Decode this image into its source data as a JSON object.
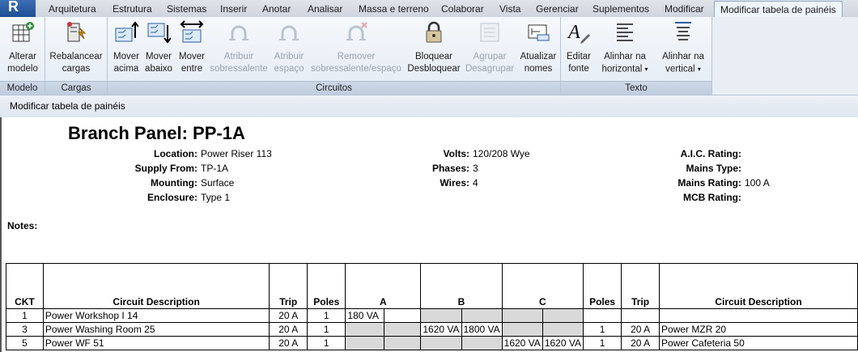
{
  "ribbon": {
    "app_button": "R",
    "tabs": [
      "Arquitetura",
      "Estrutura",
      "Sistemas",
      "Inserir",
      "Anotar",
      "Analisar",
      "Massa e terreno",
      "Colaborar",
      "Vista",
      "Gerenciar",
      "Suplementos",
      "Modificar",
      "Modificar tabela de painéis"
    ],
    "active_tab": "Modificar tabela de painéis",
    "panels": {
      "modelo": {
        "label": "Modelo",
        "buttons": [
          {
            "line1": "Alterar",
            "line2": "modelo",
            "icon": "table-swap-icon"
          }
        ]
      },
      "cargas": {
        "label": "Cargas",
        "buttons": [
          {
            "line1": "Rebalancear",
            "line2": "cargas",
            "icon": "rebalance-icon"
          }
        ]
      },
      "circuitos": {
        "label": "Circuitos",
        "buttons": [
          {
            "line1": "Mover",
            "line2": "acima",
            "icon": "move-up-icon"
          },
          {
            "line1": "Mover",
            "line2": "abaixo",
            "icon": "move-down-icon"
          },
          {
            "line1": "Mover",
            "line2": "entre",
            "icon": "move-across-icon"
          },
          {
            "line1": "Atribuir",
            "line2": "sobressalente",
            "icon": "assign-spare-icon"
          },
          {
            "line1": "Atribuir",
            "line2": "espaço",
            "icon": "assign-space-icon"
          },
          {
            "line1": "Remover",
            "line2": "sobressalente/espaço",
            "icon": "remove-spare-icon"
          },
          {
            "line1": "Bloquear",
            "line2": "Desbloquear",
            "icon": "lock-icon"
          },
          {
            "line1": "Agrupar",
            "line2": "Desagrupar",
            "icon": "group-icon"
          },
          {
            "line1": "Atualizar",
            "line2": "nomes",
            "icon": "update-names-icon"
          }
        ]
      },
      "texto": {
        "label": "Texto",
        "buttons": [
          {
            "line1": "Editar",
            "line2": "fonte",
            "icon": "font-edit-icon"
          },
          {
            "line1": "Alinhar na",
            "line2": "horizontal",
            "icon": "align-horizontal-icon"
          },
          {
            "line1": "Alinhar na",
            "line2": "vertical",
            "icon": "align-vertical-icon"
          }
        ]
      }
    }
  },
  "options_bar": {
    "label": "Modificar tabela de painéis"
  },
  "schedule": {
    "title": "Branch Panel: PP-1A",
    "info_left": [
      {
        "label": "Location:",
        "value": "Power Riser 113"
      },
      {
        "label": "Supply From:",
        "value": "TP-1A"
      },
      {
        "label": "Mounting:",
        "value": "Surface"
      },
      {
        "label": "Enclosure:",
        "value": "Type 1"
      }
    ],
    "info_mid": [
      {
        "label": "Volts:",
        "value": "120/208 Wye"
      },
      {
        "label": "Phases:",
        "value": "3"
      },
      {
        "label": "Wires:",
        "value": "4"
      }
    ],
    "info_right": [
      {
        "label": "A.I.C. Rating:",
        "value": ""
      },
      {
        "label": "Mains Type:",
        "value": ""
      },
      {
        "label": "Mains Rating:",
        "value": "100 A"
      },
      {
        "label": "MCB Rating:",
        "value": ""
      }
    ],
    "notes_label": "Notes:",
    "columns": [
      "CKT",
      "Circuit Description",
      "Trip",
      "Poles",
      "A",
      "B",
      "C",
      "Poles",
      "Trip",
      "Circuit Description"
    ],
    "rows": [
      {
        "ckt": "1",
        "desc": "Power Workshop I 14",
        "trip": "20 A",
        "poles": "1",
        "a1": "180 VA",
        "a2": "",
        "b1": "",
        "b2": "",
        "c1": "",
        "c2": "",
        "poles_r": "",
        "trip_r": "",
        "desc_r": ""
      },
      {
        "ckt": "3",
        "desc": "Power Washing Room 25",
        "trip": "20 A",
        "poles": "1",
        "a1": "",
        "a2": "",
        "b1": "1620 VA",
        "b2": "1800 VA",
        "c1": "",
        "c2": "",
        "poles_r": "1",
        "trip_r": "20 A",
        "desc_r": "Power MZR 20"
      },
      {
        "ckt": "5",
        "desc": "Power WF 51",
        "trip": "20 A",
        "poles": "1",
        "a1": "",
        "a2": "",
        "b1": "",
        "b2": "",
        "c1": "1620 VA",
        "c2": "1620 VA",
        "poles_r": "1",
        "trip_r": "20 A",
        "desc_r": "Power Cafeteria 50"
      }
    ]
  }
}
